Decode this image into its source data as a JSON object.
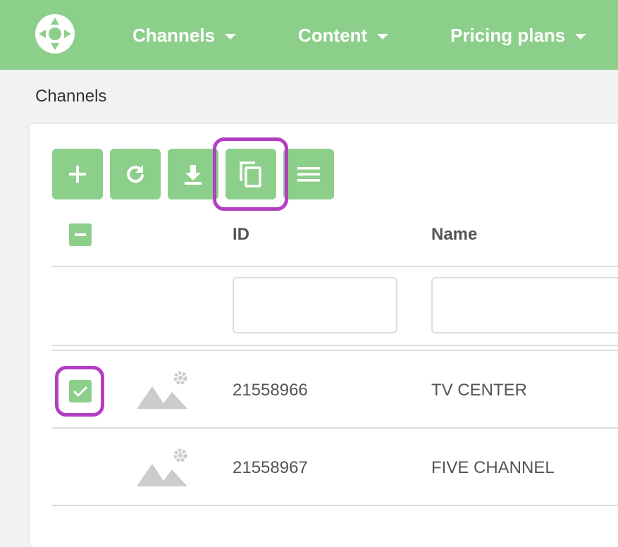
{
  "nav": {
    "items": [
      {
        "label": "Channels"
      },
      {
        "label": "Content"
      },
      {
        "label": "Pricing plans"
      }
    ]
  },
  "breadcrumb": "Channels",
  "toolbar": {
    "buttons": [
      {
        "icon": "plus-icon"
      },
      {
        "icon": "refresh-icon"
      },
      {
        "icon": "download-icon"
      },
      {
        "icon": "copy-icon",
        "highlighted": true
      },
      {
        "icon": "menu-icon"
      }
    ]
  },
  "table": {
    "columns": [
      "ID",
      "Name"
    ],
    "filters": {
      "id_value": "",
      "name_value": ""
    },
    "rows": [
      {
        "id": "21558966",
        "name": "TV CENTER",
        "checked": true
      },
      {
        "id": "21558967",
        "name": "FIVE CHANNEL",
        "checked": false
      }
    ]
  },
  "colors": {
    "accent": "#8ccf8a",
    "highlight": "#b23ec2"
  }
}
